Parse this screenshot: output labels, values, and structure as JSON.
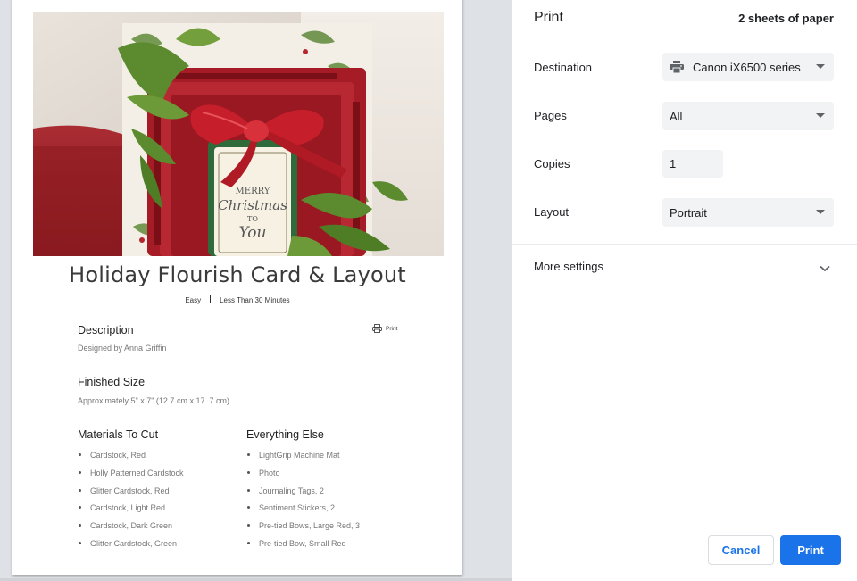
{
  "document": {
    "title": "Holiday Flourish Card & Layout",
    "difficulty": "Easy",
    "duration": "Less Than 30 Minutes",
    "print_link": "Print",
    "photo": {
      "tag_lines": [
        "MERRY",
        "Christmas",
        "TO",
        "You"
      ]
    },
    "description": {
      "heading": "Description",
      "text": "Designed by Anna Griffin"
    },
    "finished_size": {
      "heading": "Finished Size",
      "text": "Approximately 5\" x 7\" (12.7 cm x 17. 7 cm)"
    },
    "materials": {
      "heading": "Materials To Cut",
      "items": [
        "Cardstock, Red",
        "Holly Patterned Cardstock",
        "Glitter Cardstock, Red",
        "Cardstock, Light Red",
        "Cardstock, Dark Green",
        "Glitter Cardstock, Green"
      ]
    },
    "everything_else": {
      "heading": "Everything Else",
      "items": [
        "LightGrip Machine Mat",
        "Photo",
        "Journaling Tags, 2",
        "Sentiment Stickers, 2",
        "Pre-tied Bows, Large Red, 3",
        "Pre-tied Bow, Small Red"
      ]
    }
  },
  "panel": {
    "title": "Print",
    "sheets": "2 sheets of paper",
    "destination": {
      "label": "Destination",
      "value": "Canon iX6500 series",
      "icon": "printer-icon"
    },
    "pages": {
      "label": "Pages",
      "value": "All"
    },
    "copies": {
      "label": "Copies",
      "value": "1"
    },
    "layout": {
      "label": "Layout",
      "value": "Portrait"
    },
    "more_settings": {
      "label": "More settings",
      "icon": "chevron-down-icon"
    },
    "buttons": {
      "cancel": "Cancel",
      "print": "Print"
    }
  },
  "colors": {
    "accent": "#1a73e8",
    "panel_bg": "#ffffff",
    "preview_bg": "#dee1e6",
    "field_bg": "#f1f3f4"
  }
}
